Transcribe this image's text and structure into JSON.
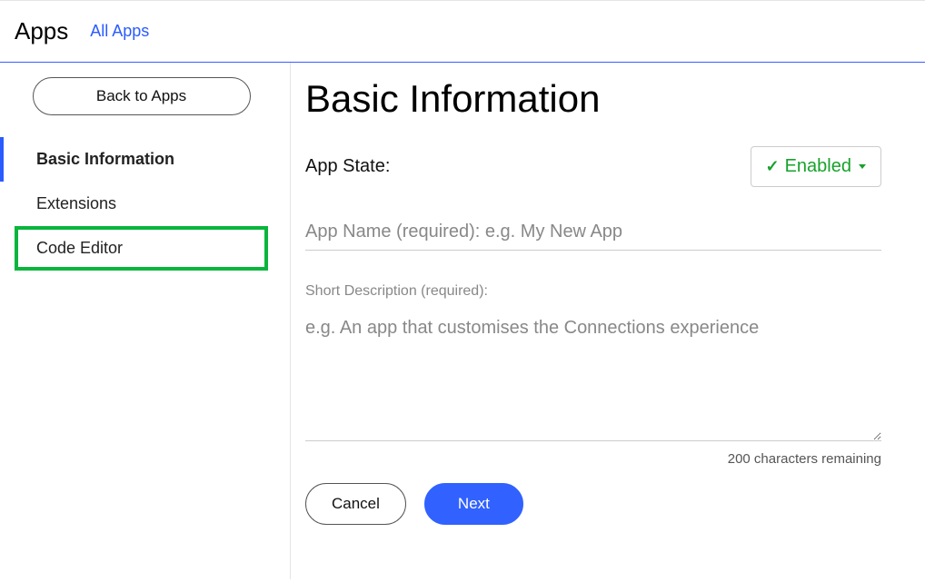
{
  "topbar": {
    "title": "Apps",
    "all_apps": "All Apps"
  },
  "sidebar": {
    "back_label": "Back to Apps",
    "items": [
      {
        "label": "Basic Information"
      },
      {
        "label": "Extensions"
      },
      {
        "label": "Code Editor"
      }
    ]
  },
  "main": {
    "heading": "Basic Information",
    "state_label": "App State:",
    "state_value": "Enabled",
    "app_name_placeholder": "App Name (required): e.g. My New App",
    "app_name_value": "",
    "desc_label": "Short Description (required):",
    "desc_placeholder": "e.g. An app that customises the Connections experience",
    "desc_value": "",
    "char_remaining": "200 characters remaining",
    "cancel_label": "Cancel",
    "next_label": "Next"
  }
}
